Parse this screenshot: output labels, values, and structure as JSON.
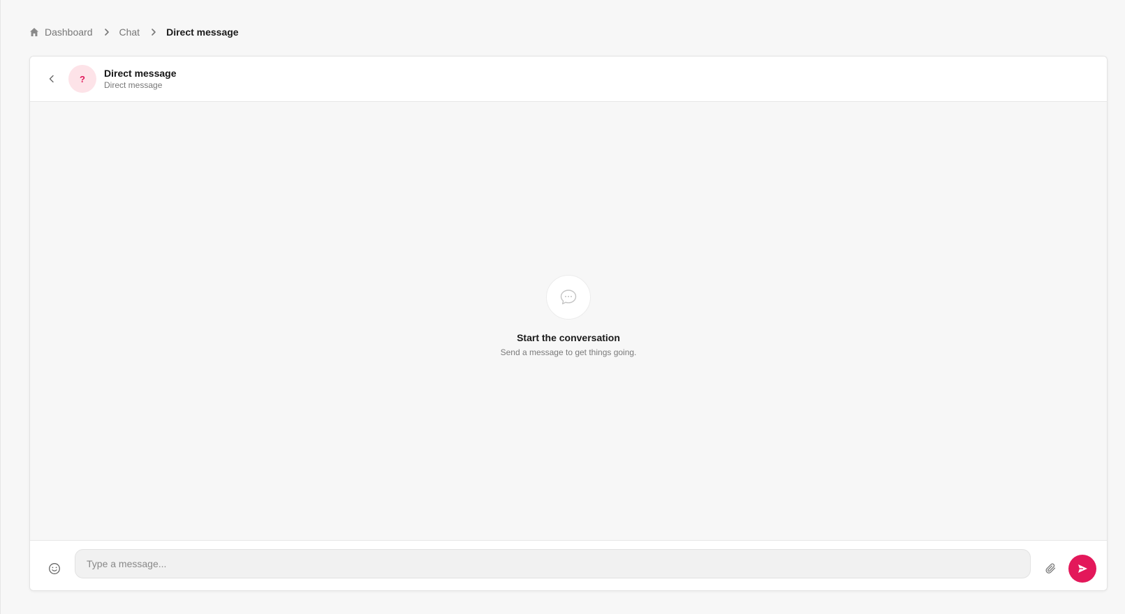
{
  "breadcrumb": {
    "items": [
      {
        "label": "Dashboard",
        "icon": "home-icon"
      },
      {
        "label": "Chat"
      },
      {
        "label": "Direct message"
      }
    ]
  },
  "header": {
    "avatar_text": "?",
    "title": "Direct message",
    "subtitle": "Direct message"
  },
  "empty_state": {
    "icon": "chat-bubble-icon",
    "title": "Start the conversation",
    "subtitle": "Send a message to get things going."
  },
  "composer": {
    "placeholder": "Type a message...",
    "value": ""
  },
  "colors": {
    "accent": "#e3185a",
    "avatar_bg": "#fde3e8"
  }
}
